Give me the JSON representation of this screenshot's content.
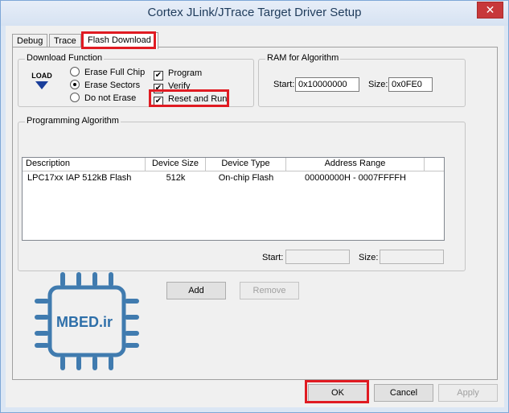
{
  "window": {
    "title": "Cortex JLink/JTrace Target Driver Setup",
    "close_glyph": "✕"
  },
  "tabs": [
    {
      "label": "Debug"
    },
    {
      "label": "Trace"
    },
    {
      "label": "Flash Download",
      "active": true
    }
  ],
  "download_function": {
    "title": "Download Function",
    "icon_label": "LOAD",
    "radios": [
      {
        "label": "Erase Full Chip",
        "checked": false
      },
      {
        "label": "Erase Sectors",
        "checked": true
      },
      {
        "label": "Do not Erase",
        "checked": false
      }
    ],
    "checks": [
      {
        "label": "Program",
        "checked": true
      },
      {
        "label": "Verify",
        "checked": true
      },
      {
        "label": "Reset and Run",
        "checked": true
      }
    ]
  },
  "ram_for_algorithm": {
    "title": "RAM for Algorithm",
    "start_label": "Start:",
    "start_value": "0x10000000",
    "size_label": "Size:",
    "size_value": "0x0FE0"
  },
  "programming_algorithm": {
    "title": "Programming Algorithm",
    "columns": [
      "Description",
      "Device Size",
      "Device Type",
      "Address Range"
    ],
    "rows": [
      [
        "LPC17xx IAP 512kB Flash",
        "512k",
        "On-chip Flash",
        "00000000H - 0007FFFFH"
      ]
    ],
    "start_label": "Start:",
    "start_value": "",
    "size_label": "Size:",
    "size_value": ""
  },
  "buttons": {
    "add": "Add",
    "remove": "Remove",
    "ok": "OK",
    "cancel": "Cancel",
    "apply": "Apply"
  },
  "watermark": {
    "text": "MBED.ir",
    "color": "#2e6fa9"
  },
  "highlight_color": "#e01b22"
}
